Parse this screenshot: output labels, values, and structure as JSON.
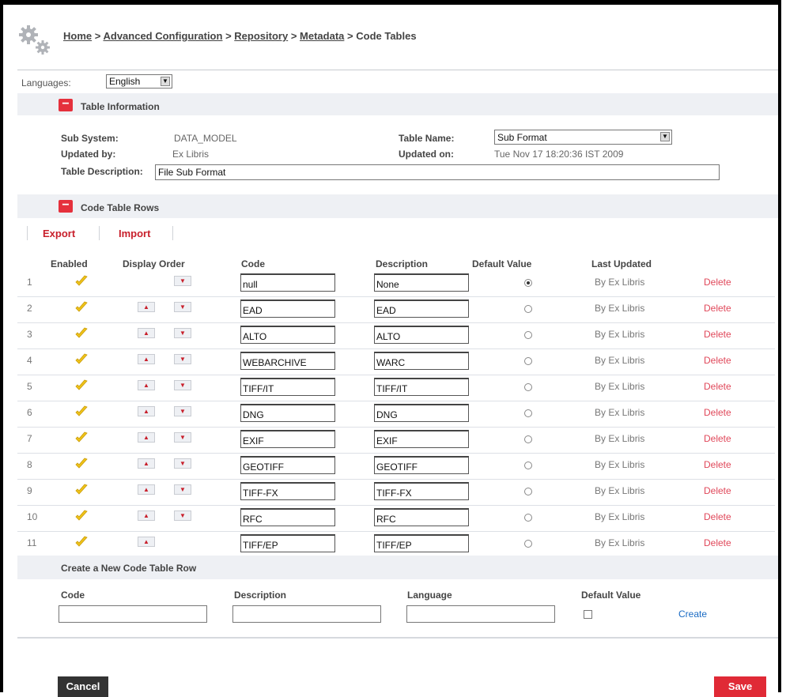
{
  "breadcrumb": {
    "items": [
      "Home",
      "Advanced Configuration",
      "Repository",
      "Metadata"
    ],
    "separator": ">",
    "current": "Code Tables"
  },
  "languages": {
    "label": "Languages:",
    "selected": "English"
  },
  "table_info": {
    "title": "Table Information",
    "sub_system_label": "Sub System:",
    "sub_system_value": "DATA_MODEL",
    "updated_by_label": "Updated by:",
    "updated_by_value": "Ex Libris",
    "table_name_label": "Table Name:",
    "table_name_value": "Sub Format",
    "updated_on_label": "Updated on:",
    "updated_on_value": "Tue Nov 17 18:20:36 IST 2009",
    "description_label": "Table Description:",
    "description_value": "File Sub Format"
  },
  "rows_section": {
    "title": "Code Table Rows",
    "export": "Export",
    "import": "Import",
    "headers": [
      "Enabled",
      "Display Order",
      "Code",
      "Description",
      "Default Value",
      "Last Updated"
    ],
    "rows": [
      {
        "num": "1",
        "code": "null",
        "desc": "None",
        "default": true,
        "up": false,
        "down": true,
        "updated": "By Ex Libris",
        "delete": "Delete"
      },
      {
        "num": "2",
        "code": "EAD",
        "desc": "EAD",
        "default": false,
        "up": true,
        "down": true,
        "updated": "By Ex Libris",
        "delete": "Delete"
      },
      {
        "num": "3",
        "code": "ALTO",
        "desc": "ALTO",
        "default": false,
        "up": true,
        "down": true,
        "updated": "By Ex Libris",
        "delete": "Delete"
      },
      {
        "num": "4",
        "code": "WEBARCHIVE",
        "desc": "WARC",
        "default": false,
        "up": true,
        "down": true,
        "updated": "By Ex Libris",
        "delete": "Delete"
      },
      {
        "num": "5",
        "code": "TIFF/IT",
        "desc": "TIFF/IT",
        "default": false,
        "up": true,
        "down": true,
        "updated": "By Ex Libris",
        "delete": "Delete"
      },
      {
        "num": "6",
        "code": "DNG",
        "desc": "DNG",
        "default": false,
        "up": true,
        "down": true,
        "updated": "By Ex Libris",
        "delete": "Delete"
      },
      {
        "num": "7",
        "code": "EXIF",
        "desc": "EXIF",
        "default": false,
        "up": true,
        "down": true,
        "updated": "By Ex Libris",
        "delete": "Delete"
      },
      {
        "num": "8",
        "code": "GEOTIFF",
        "desc": "GEOTIFF",
        "default": false,
        "up": true,
        "down": true,
        "updated": "By Ex Libris",
        "delete": "Delete"
      },
      {
        "num": "9",
        "code": "TIFF-FX",
        "desc": "TIFF-FX",
        "default": false,
        "up": true,
        "down": true,
        "updated": "By Ex Libris",
        "delete": "Delete"
      },
      {
        "num": "10",
        "code": "RFC",
        "desc": "RFC",
        "default": false,
        "up": true,
        "down": true,
        "updated": "By Ex Libris",
        "delete": "Delete"
      },
      {
        "num": "11",
        "code": "TIFF/EP",
        "desc": "TIFF/EP",
        "default": false,
        "up": true,
        "down": false,
        "updated": "By Ex Libris",
        "delete": "Delete"
      }
    ]
  },
  "new_row": {
    "title": "Create a New Code Table Row",
    "code_label": "Code",
    "description_label": "Description",
    "language_label": "Language",
    "default_label": "Default Value",
    "create": "Create"
  },
  "buttons": {
    "cancel": "Cancel",
    "save": "Save"
  },
  "colors": {
    "accent": "#e5303c",
    "band": "#eef0f4",
    "link": "#1a6bc4",
    "dark_button": "#333333"
  }
}
